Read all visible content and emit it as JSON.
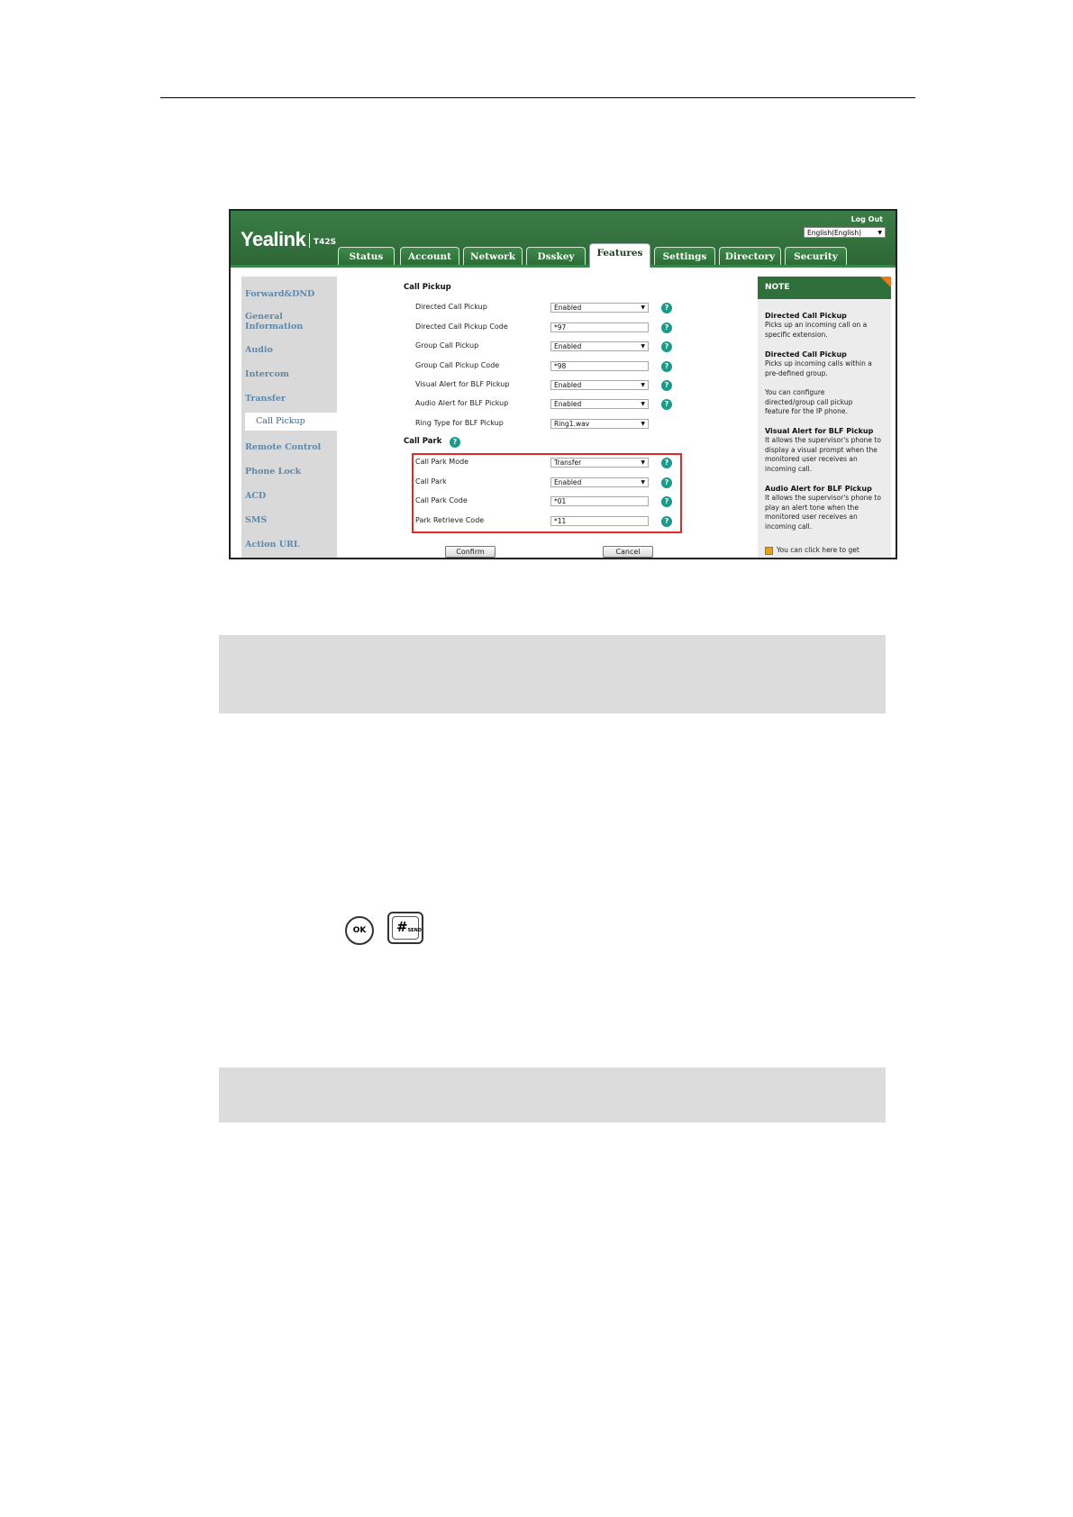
{
  "ui": {
    "logo": "Yealink",
    "model": "T42S",
    "logout": "Log Out",
    "language": "English(English)",
    "tabs": [
      "Status",
      "Account",
      "Network",
      "Dsskey",
      "Features",
      "Settings",
      "Directory",
      "Security"
    ],
    "active_tab": "Features",
    "nav": [
      "Forward&DND",
      "General Information",
      "Audio",
      "Intercom",
      "Transfer",
      "Call Pickup",
      "Remote Control",
      "Phone Lock",
      "ACD",
      "SMS",
      "Action URL"
    ],
    "active_nav": "Call Pickup",
    "call_pickup_title": "Call Pickup",
    "call_park_title": "Call Park",
    "rows": [
      {
        "label": "Directed Call Pickup",
        "value": "Enabled",
        "type": "select"
      },
      {
        "label": "Directed Call Pickup Code",
        "value": "*97",
        "type": "input"
      },
      {
        "label": "Group Call Pickup",
        "value": "Enabled",
        "type": "select"
      },
      {
        "label": "Group Call Pickup Code",
        "value": "*98",
        "type": "input"
      },
      {
        "label": "Visual Alert for BLF Pickup",
        "value": "Enabled",
        "type": "select"
      },
      {
        "label": "Audio Alert for BLF Pickup",
        "value": "Enabled",
        "type": "select"
      },
      {
        "label": "Ring Type for BLF Pickup",
        "value": "Ring1.wav",
        "type": "select"
      }
    ],
    "park_rows": [
      {
        "label": "Call Park Mode",
        "value": "Transfer",
        "type": "select"
      },
      {
        "label": "Call Park",
        "value": "Enabled",
        "type": "select"
      },
      {
        "label": "Call Park Code",
        "value": "*01",
        "type": "input"
      },
      {
        "label": "Park Retrieve Code",
        "value": "*11",
        "type": "input"
      }
    ],
    "confirm": "Confirm",
    "cancel": "Cancel",
    "note": {
      "title": "NOTE",
      "blocks": [
        {
          "t": "Directed Call Pickup",
          "b": "Picks up an incoming call on a specific extension."
        },
        {
          "t": "Directed Call Pickup",
          "b": "Picks up incoming calls within a pre-defined group."
        },
        {
          "t": "",
          "b": "You can configure directed/group call pickup feature for the IP phone."
        },
        {
          "t": "Visual Alert for BLF Pickup",
          "b": "It allows the supervisor's phone to display a visual prompt when the monitored user receives an incoming call."
        },
        {
          "t": "Audio Alert for BLF Pickup",
          "b": "It allows the supervisor's phone to play an alert tone when the monitored user receives an incoming call."
        }
      ],
      "footer": "You can click here to get"
    },
    "help_icon": "?"
  },
  "keys": {
    "ok": "OK",
    "hash": "#",
    "hash_sub": "SEND"
  }
}
